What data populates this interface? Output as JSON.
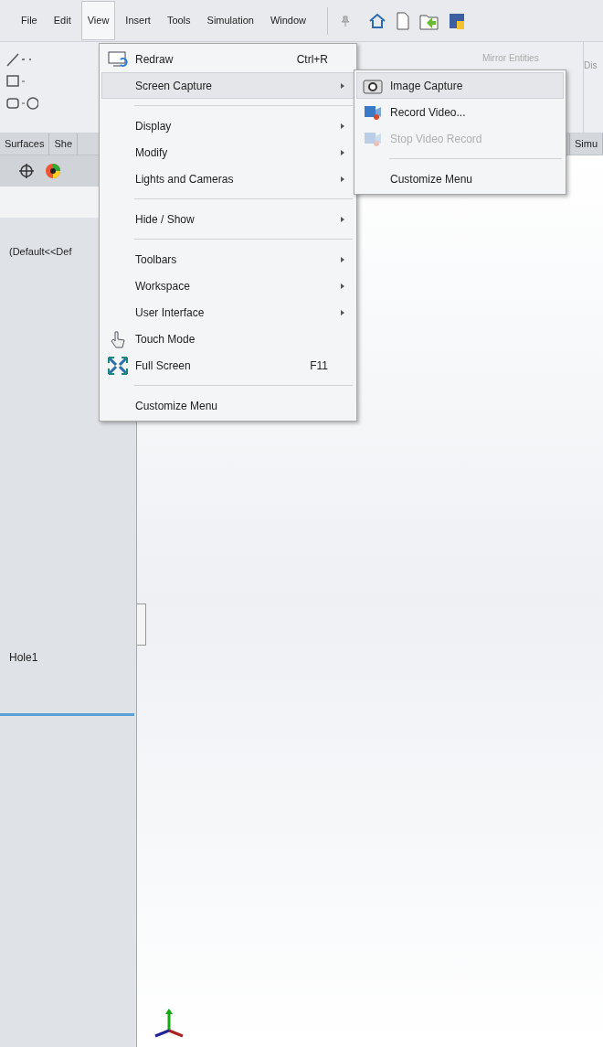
{
  "menu_bar": [
    {
      "label": "File",
      "selected": false
    },
    {
      "label": "Edit",
      "selected": false
    },
    {
      "label": "View",
      "selected": true
    },
    {
      "label": "Insert",
      "selected": false
    },
    {
      "label": "Tools",
      "selected": false
    },
    {
      "label": "Simulation",
      "selected": false
    },
    {
      "label": "Window",
      "selected": false
    }
  ],
  "toolbar": {
    "mirror_entities": "Mirror Entities",
    "column_cut": "Dis"
  },
  "tabs": [
    {
      "label": "Surfaces",
      "selected": false
    },
    {
      "label": "She",
      "selected": false
    },
    {
      "label": "Simu",
      "selected": false
    }
  ],
  "tree": {
    "config": "(Default<<Def",
    "feature": "Hole1"
  },
  "view_menu": [
    {
      "kind": "item",
      "label": "Redraw",
      "shortcut": "Ctrl+R",
      "submenu": false,
      "selected": false
    },
    {
      "kind": "item",
      "label": "Screen Capture",
      "submenu": true,
      "selected": true
    },
    {
      "kind": "separator"
    },
    {
      "kind": "item",
      "label": "Display",
      "submenu": true,
      "selected": false
    },
    {
      "kind": "item",
      "label": "Modify",
      "submenu": true,
      "selected": false
    },
    {
      "kind": "item",
      "label": "Lights and Cameras",
      "submenu": true,
      "selected": false
    },
    {
      "kind": "separator"
    },
    {
      "kind": "item",
      "label": "Hide / Show",
      "submenu": true,
      "selected": false
    },
    {
      "kind": "separator"
    },
    {
      "kind": "item",
      "label": "Toolbars",
      "submenu": true,
      "selected": false
    },
    {
      "kind": "item",
      "label": "Workspace",
      "submenu": true,
      "selected": false
    },
    {
      "kind": "item",
      "label": "User Interface",
      "submenu": true,
      "selected": false
    },
    {
      "kind": "item",
      "label": "Touch Mode",
      "submenu": false,
      "selected": false
    },
    {
      "kind": "item",
      "label": "Full Screen",
      "shortcut": "F11",
      "submenu": false,
      "selected": false
    },
    {
      "kind": "separator"
    },
    {
      "kind": "item",
      "label": "Customize Menu",
      "submenu": false,
      "selected": false
    }
  ],
  "screen_capture_menu": [
    {
      "kind": "item",
      "label": "Image Capture",
      "selected": true,
      "disabled": false
    },
    {
      "kind": "item",
      "label": "Record Video...",
      "selected": false,
      "disabled": false
    },
    {
      "kind": "item",
      "label": "Stop Video Record",
      "selected": false,
      "disabled": true
    },
    {
      "kind": "separator"
    },
    {
      "kind": "item",
      "label": "Customize Menu",
      "selected": false,
      "disabled": false
    }
  ]
}
